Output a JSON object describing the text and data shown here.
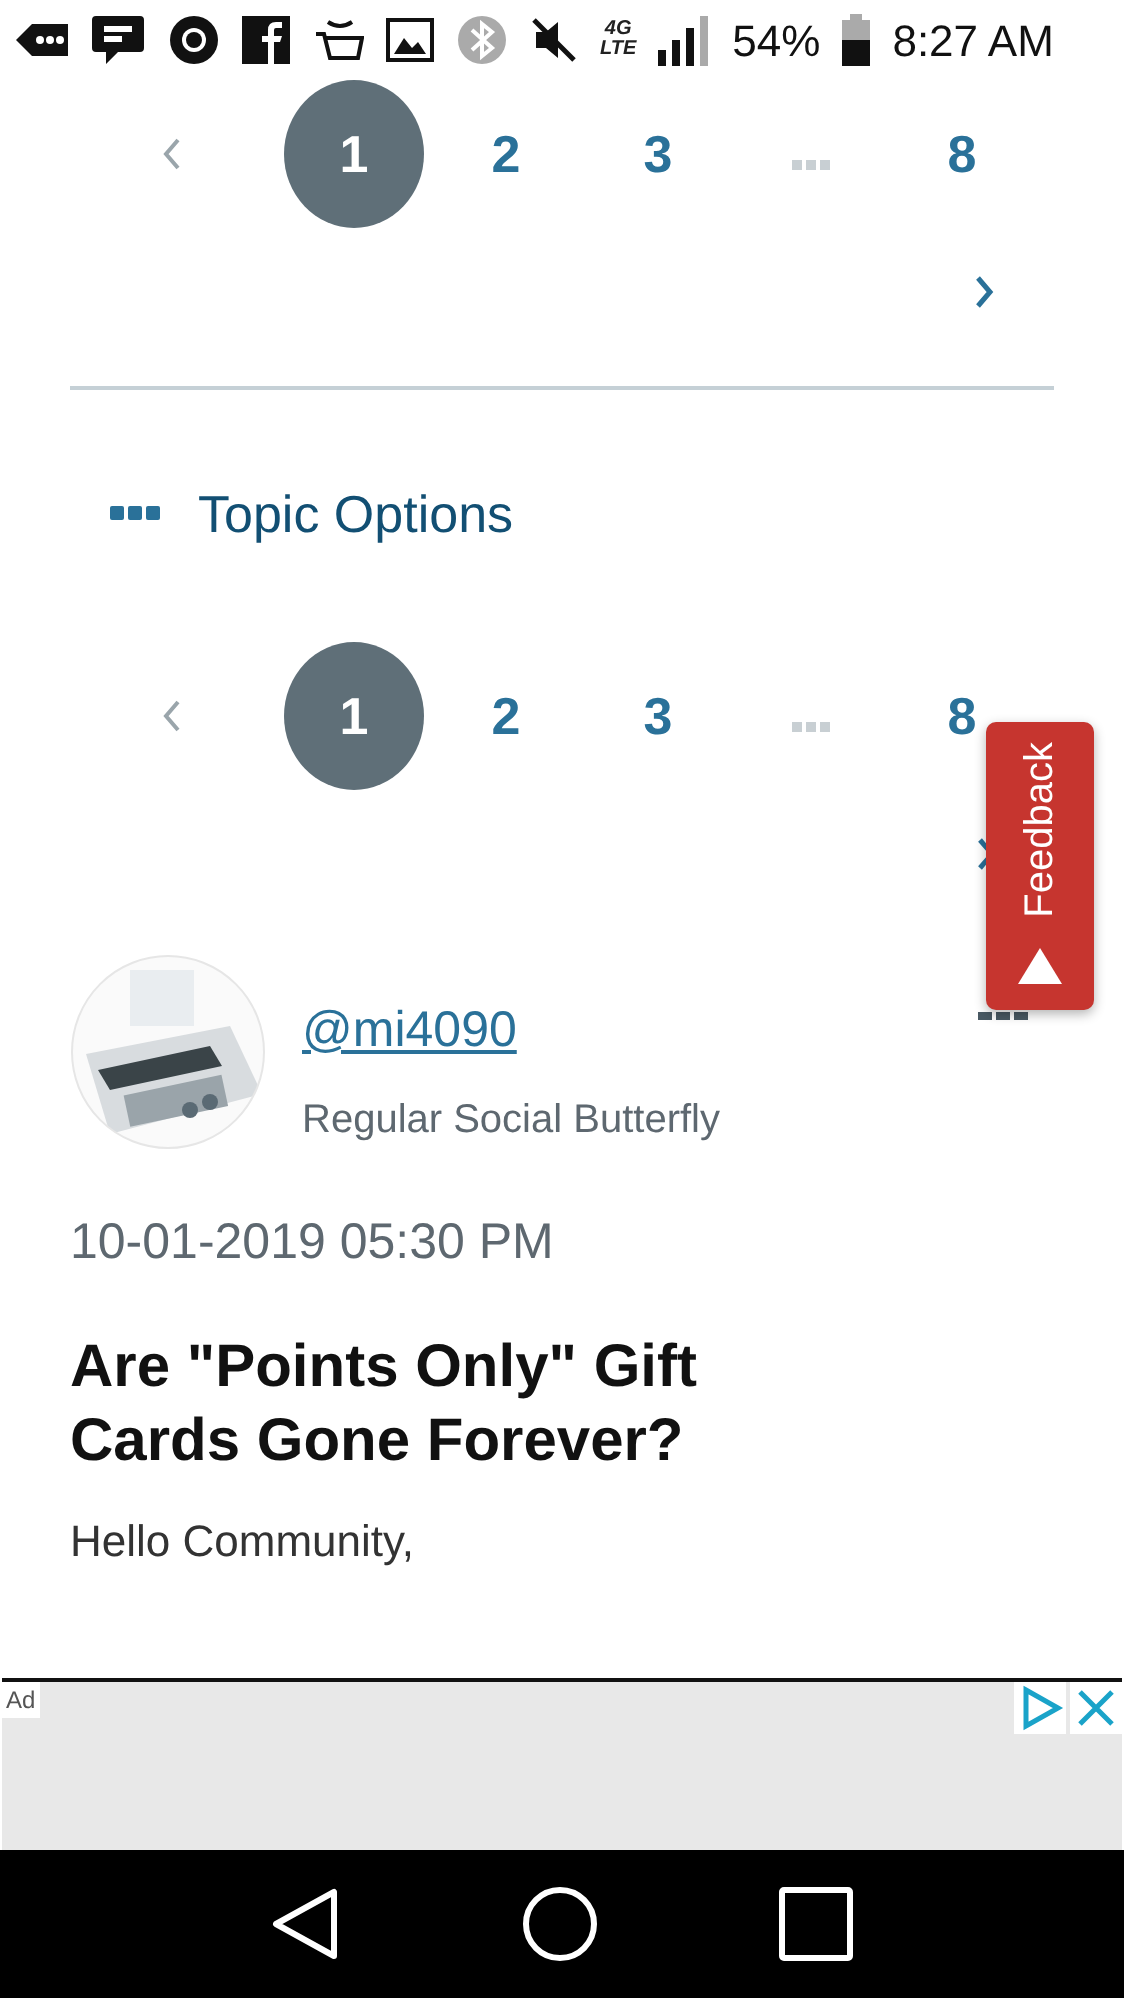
{
  "status_bar": {
    "network_top": "4G",
    "network_bottom": "LTE",
    "battery": "54%",
    "time": "8:27 AM"
  },
  "pager_top": {
    "pages": [
      {
        "label": "1",
        "selected": true
      },
      {
        "label": "2",
        "selected": false
      },
      {
        "label": "3",
        "selected": false
      },
      {
        "label": "8",
        "selected": false
      }
    ]
  },
  "topic_options": {
    "label": "Topic Options"
  },
  "pager_bottom": {
    "pages": [
      {
        "label": "1",
        "selected": true
      },
      {
        "label": "2",
        "selected": false
      },
      {
        "label": "3",
        "selected": false
      },
      {
        "label": "8",
        "selected": false
      }
    ]
  },
  "feedback": {
    "label": "Feedback"
  },
  "post": {
    "author": "@mi4090",
    "rank": "Regular Social Butterfly",
    "date": "10-01-2019 05:30 PM",
    "title": "Are \"Points Only\" Gift Cards Gone Forever?",
    "body": "Hello Community,"
  },
  "ad": {
    "label": "Ad"
  }
}
